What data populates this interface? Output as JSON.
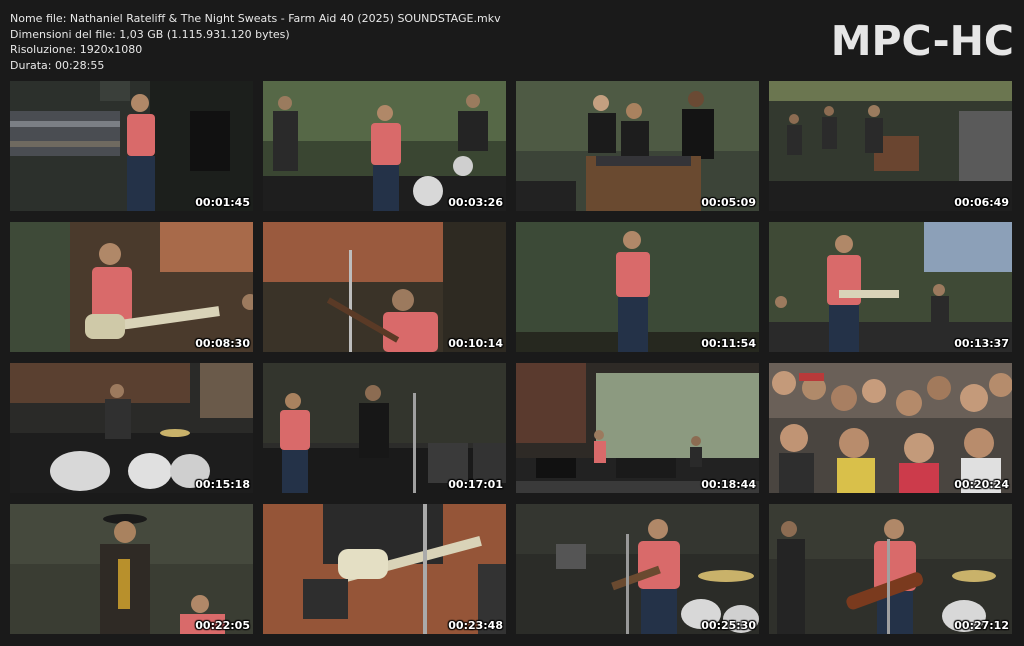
{
  "file_info": {
    "name_line": "Nome file: Nathaniel Rateliff & The Night Sweats - Farm Aid 40 (2025) SOUNDSTAGE.mkv",
    "size_line": "Dimensioni del file: 1,03 GB (1.115.931.120 bytes)",
    "resolution_line": "Risoluzione: 1920x1080",
    "duration_line": "Durata: 00:28:55"
  },
  "logo_text": "MPC-HC",
  "thumbnails": [
    {
      "timestamp": "00:01:45"
    },
    {
      "timestamp": "00:03:26"
    },
    {
      "timestamp": "00:05:09"
    },
    {
      "timestamp": "00:06:49"
    },
    {
      "timestamp": "00:08:30"
    },
    {
      "timestamp": "00:10:14"
    },
    {
      "timestamp": "00:11:54"
    },
    {
      "timestamp": "00:13:37"
    },
    {
      "timestamp": "00:15:18"
    },
    {
      "timestamp": "00:17:01"
    },
    {
      "timestamp": "00:18:44"
    },
    {
      "timestamp": "00:20:24"
    },
    {
      "timestamp": "00:22:05"
    },
    {
      "timestamp": "00:23:48"
    },
    {
      "timestamp": "00:25:30"
    },
    {
      "timestamp": "00:27:12"
    }
  ]
}
